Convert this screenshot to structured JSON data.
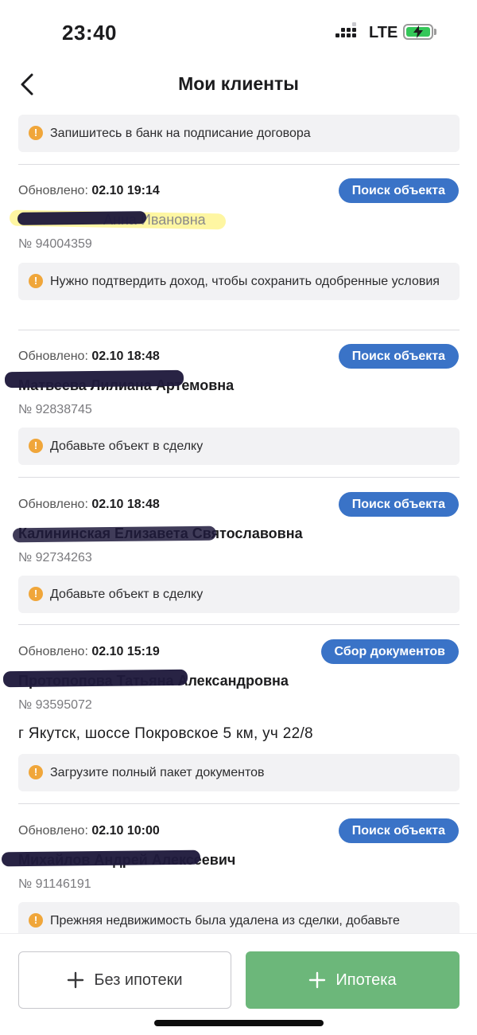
{
  "status_bar": {
    "time": "23:40",
    "network": "LTE"
  },
  "header": {
    "title": "Мои клиенты"
  },
  "top_notice": "Запишитесь в банк на подписание договора",
  "clients": [
    {
      "updated_label": "Обновлено:",
      "updated_value": "02.10 19:14",
      "status": "Поиск объекта",
      "name": "Анна Ивановна",
      "number": "№ 94004359",
      "address": "",
      "notice": "Нужно подтвердить доход, чтобы сохранить одобренные условия"
    },
    {
      "updated_label": "Обновлено:",
      "updated_value": "02.10 18:48",
      "status": "Поиск объекта",
      "name": "Матвеева Лилиана Артемовна",
      "number": "№ 92838745",
      "address": "",
      "notice": "Добавьте объект в сделку"
    },
    {
      "updated_label": "Обновлено:",
      "updated_value": "02.10 18:48",
      "status": "Поиск объекта",
      "name": "Калининская Елизавета Святославовна",
      "number": "№ 92734263",
      "address": "",
      "notice": "Добавьте объект в сделку"
    },
    {
      "updated_label": "Обновлено:",
      "updated_value": "02.10 15:19",
      "status": "Сбор документов",
      "name": "Протопопова Татьяна Александровна",
      "number": "№ 93595072",
      "address": "г Якутск, шоссе Покровское 5 км, уч 22/8",
      "notice": "Загрузите полный пакет документов"
    },
    {
      "updated_label": "Обновлено:",
      "updated_value": "02.10 10:00",
      "status": "Поиск объекта",
      "name": "Михайлов Андрей Алексеевич",
      "number": "№ 91146191",
      "address": "",
      "notice": "Прежняя недвижимость была удалена из сделки, добавьте"
    }
  ],
  "bottom_bar": {
    "no_mortgage_label": "Без ипотеки",
    "mortgage_label": "Ипотека"
  },
  "colors": {
    "accent_blue": "#3a73c7",
    "primary_green": "#6cb77a",
    "warning_orange": "#f0a63a"
  },
  "icons": {
    "back": "chevron-left-icon",
    "warning": "exclamation-circle-icon",
    "plus": "plus-icon"
  }
}
